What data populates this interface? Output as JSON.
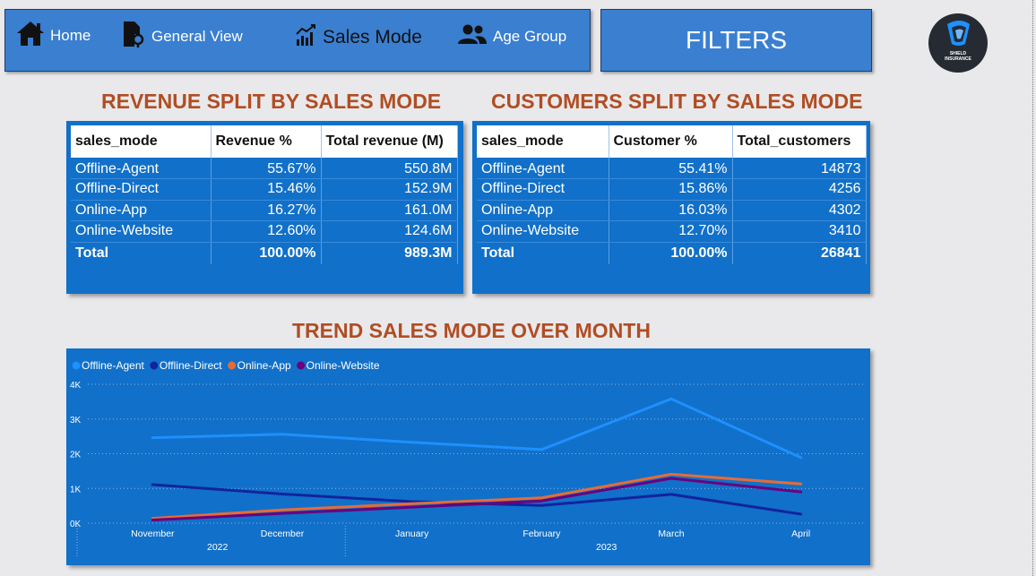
{
  "nav": {
    "home": {
      "label": "Home",
      "icon": "home-icon"
    },
    "general": {
      "label": "General View",
      "icon": "document-pin-icon"
    },
    "sales": {
      "label": "Sales Mode",
      "icon": "sales-chart-icon"
    },
    "age": {
      "label": "Age Group",
      "icon": "people-icon"
    }
  },
  "filters_label": "FILTERS",
  "logo": {
    "line1": "SHIELD",
    "line2": "INSURANCE"
  },
  "revenue_table": {
    "title": "REVENUE SPLIT BY SALES MODE",
    "headers": [
      "sales_mode",
      "Revenue %",
      "Total revenue (M)"
    ],
    "rows": [
      [
        "Offline-Agent",
        "55.67%",
        "550.8M"
      ],
      [
        "Offline-Direct",
        "15.46%",
        "152.9M"
      ],
      [
        "Online-App",
        "16.27%",
        "161.0M"
      ],
      [
        "Online-Website",
        "12.60%",
        "124.6M"
      ]
    ],
    "total": [
      "Total",
      "100.00%",
      "989.3M"
    ]
  },
  "customers_table": {
    "title": "CUSTOMERS SPLIT BY SALES MODE",
    "headers": [
      "sales_mode",
      "Customer %",
      "Total_customers"
    ],
    "rows": [
      [
        "Offline-Agent",
        "55.41%",
        "14873"
      ],
      [
        "Offline-Direct",
        "15.86%",
        "4256"
      ],
      [
        "Online-App",
        "16.03%",
        "4302"
      ],
      [
        "Online-Website",
        "12.70%",
        "3410"
      ]
    ],
    "total": [
      "Total",
      "100.00%",
      "26841"
    ]
  },
  "trend_title": "TREND SALES MODE OVER MONTH",
  "chart_data": {
    "type": "line",
    "title": "TREND SALES MODE OVER MONTH",
    "x": [
      "November",
      "December",
      "January",
      "February",
      "March",
      "April"
    ],
    "x_groups": [
      {
        "label": "2022",
        "months": [
          "November",
          "December"
        ]
      },
      {
        "label": "2023",
        "months": [
          "January",
          "February",
          "March",
          "April"
        ]
      }
    ],
    "y_ticks": [
      "0K",
      "1K",
      "2K",
      "3K",
      "4K"
    ],
    "ylim": [
      0,
      4000
    ],
    "grid": true,
    "legend_position": "top-left",
    "series": [
      {
        "name": "Offline-Agent",
        "color": "#1e90ff",
        "values": [
          2460,
          2560,
          2330,
          2120,
          3580,
          1890
        ]
      },
      {
        "name": "Offline-Direct",
        "color": "#12239e",
        "values": [
          1110,
          840,
          620,
          510,
          830,
          260
        ]
      },
      {
        "name": "Online-App",
        "color": "#e66c37",
        "values": [
          140,
          380,
          560,
          730,
          1410,
          1130
        ]
      },
      {
        "name": "Online-Website",
        "color": "#6b007b",
        "values": [
          90,
          280,
          460,
          640,
          1290,
          900
        ]
      }
    ]
  }
}
